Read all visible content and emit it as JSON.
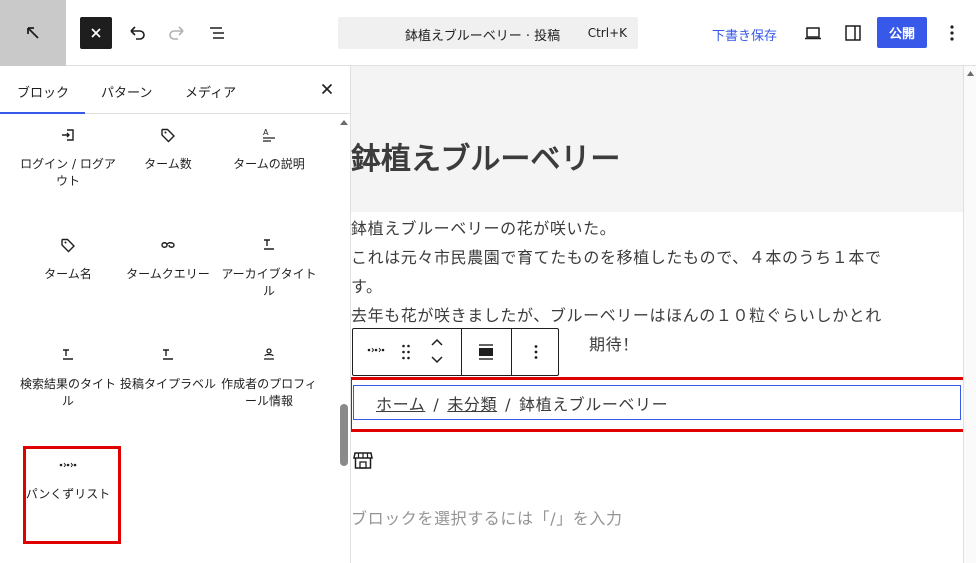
{
  "header": {
    "document_title": "鉢植えブルーベリー · 投稿",
    "shortcut": "Ctrl+K",
    "save_draft": "下書き保存",
    "publish": "公開"
  },
  "inserter": {
    "tabs": [
      "ブロック",
      "パターン",
      "メディア"
    ],
    "blocks": [
      {
        "label": "ログイン / ログアウト",
        "icon": "login-icon"
      },
      {
        "label": "ターム数",
        "icon": "tag-icon"
      },
      {
        "label": "タームの説明",
        "icon": "term-description-icon"
      },
      {
        "label": "ターム名",
        "icon": "tag-icon"
      },
      {
        "label": "タームクエリー",
        "icon": "term-query-icon"
      },
      {
        "label": "アーカイブタイトル",
        "icon": "title-icon"
      },
      {
        "label": "検索結果のタイトル",
        "icon": "title-icon"
      },
      {
        "label": "投稿タイプラベル",
        "icon": "title-icon"
      },
      {
        "label": "作成者のプロフィール情報",
        "icon": "author-icon"
      },
      {
        "label": "パンくずリスト",
        "icon": "breadcrumbs-icon"
      }
    ]
  },
  "editor": {
    "post_title": "鉢植えブルーベリー",
    "paragraph_lines": [
      "鉢植えブルーベリーの花が咲いた。",
      "これは元々市民農園で育てたものを移植したもので、４本のうち１本で",
      "す。",
      "去年も花が咲きましたが、ブルーベリーはほんの１０粒ぐらいしかとれ",
      "期待！"
    ],
    "breadcrumbs": [
      "ホーム",
      "未分類",
      "鉢植えブルーベリー"
    ],
    "breadcrumb_separator": "/",
    "placeholder": "ブロックを選択するには「/」を入力"
  },
  "colors": {
    "accent": "#3858e9",
    "highlight": "#e00000"
  }
}
